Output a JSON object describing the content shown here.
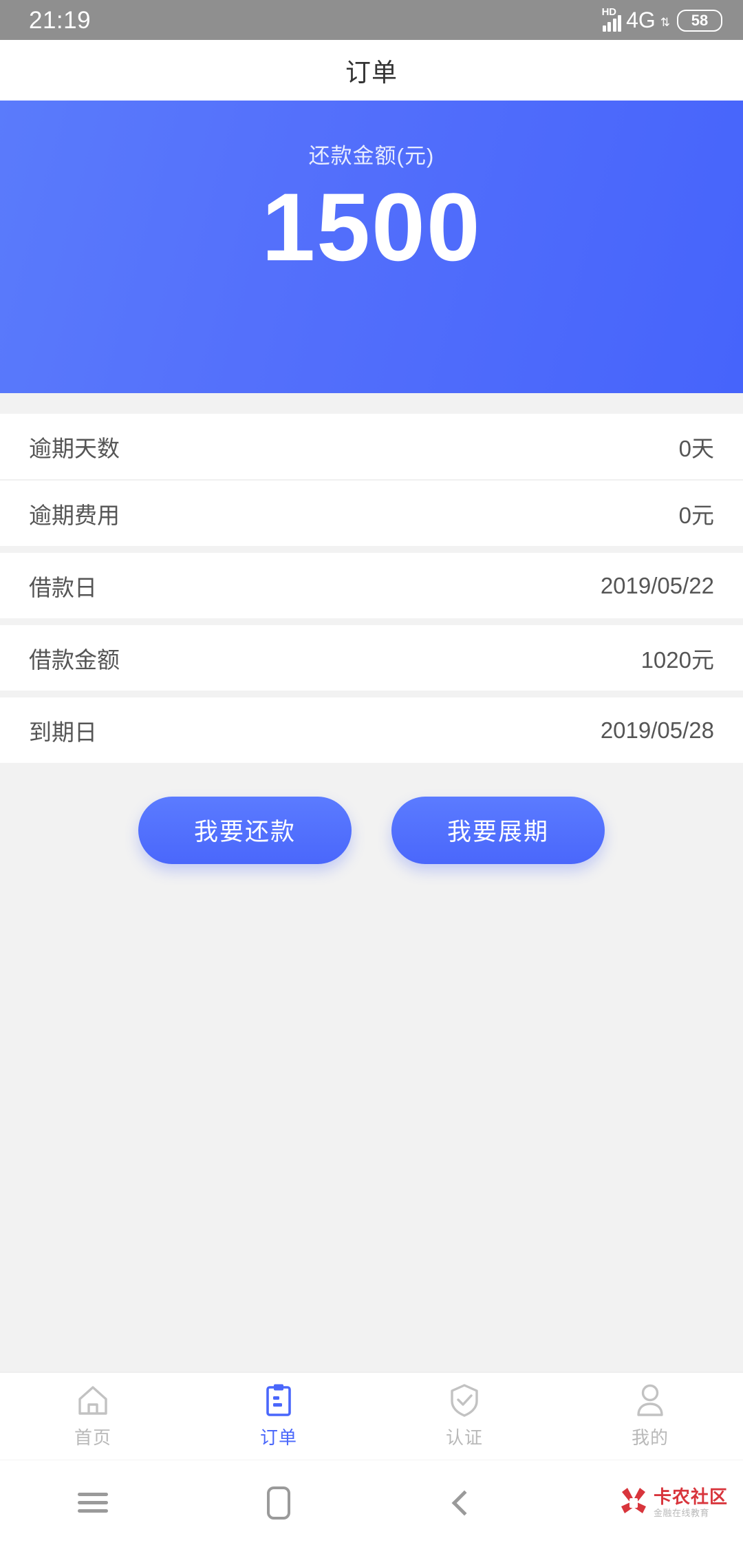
{
  "status_bar": {
    "time": "21:19",
    "hd_label": "HD",
    "network": "4G",
    "data_arrows": "⇅",
    "battery": "58",
    "background": "#8f8f8f"
  },
  "header": {
    "title": "订单"
  },
  "hero": {
    "label": "还款金额(元)",
    "amount": "1500",
    "gradient_from": "#5a7bfb",
    "gradient_to": "#4664fb"
  },
  "details": {
    "rows": [
      {
        "label": "逾期天数",
        "value": "0天"
      },
      {
        "label": "逾期费用",
        "value": "0元"
      },
      {
        "label": "借款日",
        "value": "2019/05/22"
      },
      {
        "label": "借款金额",
        "value": "1020元"
      },
      {
        "label": "到期日",
        "value": "2019/05/28"
      }
    ]
  },
  "actions": {
    "repay_label": "我要还款",
    "extend_label": "我要展期",
    "accent": "#4a67fb"
  },
  "tabbar": {
    "active_color": "#4a67fb",
    "inactive_color": "#b9b9b9",
    "tabs": [
      {
        "label": "首页",
        "icon": "home-icon",
        "active": false
      },
      {
        "label": "订单",
        "icon": "clipboard-icon",
        "active": true
      },
      {
        "label": "认证",
        "icon": "shield-check-icon",
        "active": false
      },
      {
        "label": "我的",
        "icon": "person-icon",
        "active": false
      }
    ]
  },
  "system_nav": {
    "recents": "menu-icon",
    "home": "home-square-icon",
    "back": "back-chevron-icon",
    "watermark_main": "卡农社区",
    "watermark_sub": "金融在线教育",
    "watermark_color": "#d8353c"
  }
}
